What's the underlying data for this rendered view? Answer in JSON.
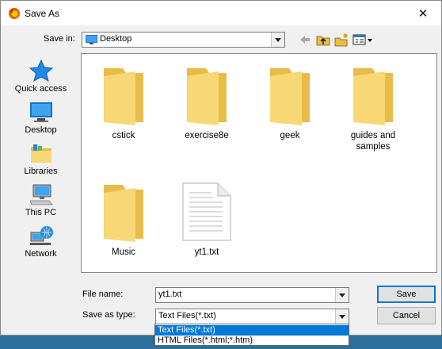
{
  "window": {
    "title": "Save As",
    "close_glyph": "✕"
  },
  "toolbar": {
    "save_in_label": "Save in:",
    "save_in_value": "Desktop",
    "icons": [
      "back-arrow-icon",
      "up-folder-icon",
      "new-folder-icon",
      "view-menu-icon"
    ]
  },
  "places": [
    {
      "label": "Quick access",
      "icon": "star-icon"
    },
    {
      "label": "Desktop",
      "icon": "desktop-icon"
    },
    {
      "label": "Libraries",
      "icon": "libraries-icon"
    },
    {
      "label": "This PC",
      "icon": "computer-icon"
    },
    {
      "label": "Network",
      "icon": "network-icon"
    }
  ],
  "files": [
    {
      "name": "cstick",
      "kind": "folder"
    },
    {
      "name": "exercise8e",
      "kind": "folder"
    },
    {
      "name": "geek",
      "kind": "folder"
    },
    {
      "name": "guides and samples",
      "kind": "folder"
    },
    {
      "name": "Music",
      "kind": "folder"
    },
    {
      "name": "yt1.txt",
      "kind": "text-file"
    }
  ],
  "form": {
    "file_name_label": "File name:",
    "file_name_value": "yt1.txt",
    "save_type_label": "Save as type:",
    "save_type_value": "Text Files(*.txt)",
    "save_type_options": [
      "Text Files(*.txt)",
      "HTML Files(*.html;*.htm)"
    ]
  },
  "buttons": {
    "save": "Save",
    "cancel": "Cancel"
  },
  "colors": {
    "folder": "#f8d775",
    "folder_dark": "#e9bc4a",
    "selection": "#0078d7",
    "taskbar": "#2b6f9c"
  }
}
